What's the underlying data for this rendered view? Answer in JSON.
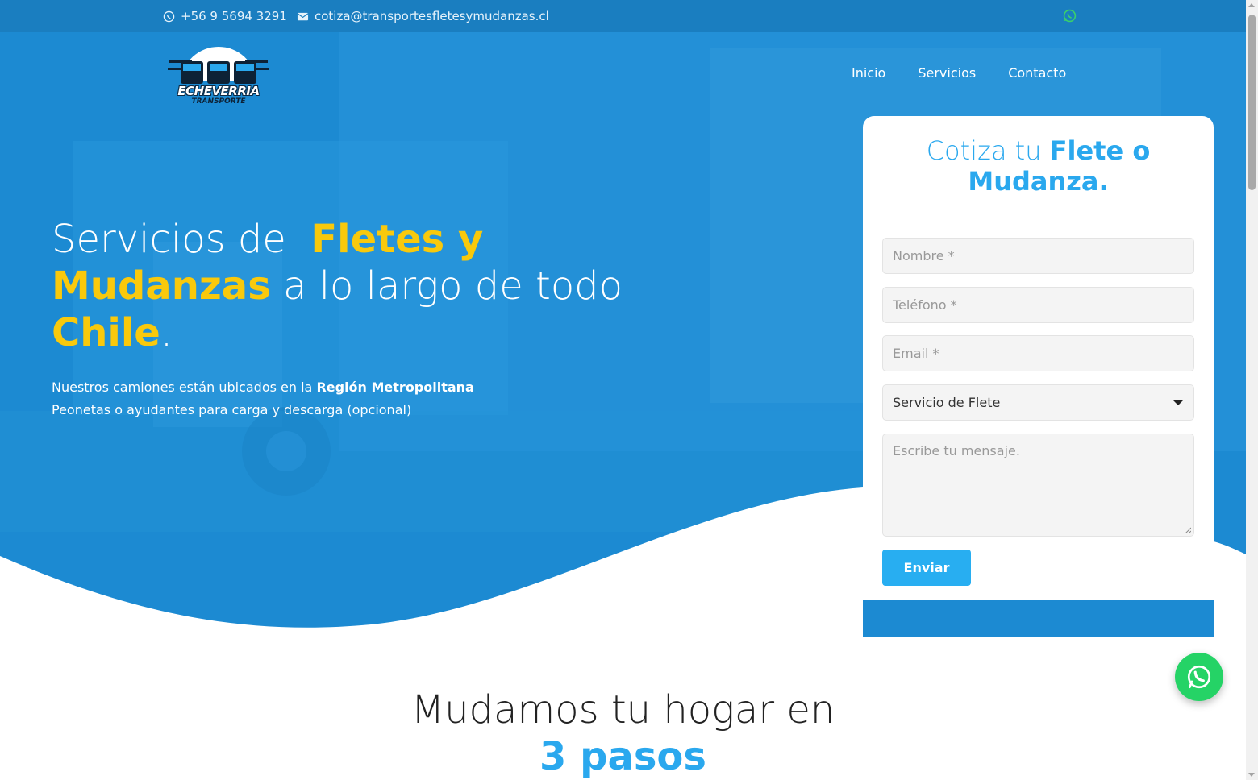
{
  "topbar": {
    "phone": "+56 9 5694 3291",
    "email": "cotiza@transportesfletesymudanzas.cl",
    "phone_icon": "whatsapp-icon",
    "email_icon": "envelope-icon",
    "social_icon": "whatsapp-icon"
  },
  "brand": {
    "name": "ECHEVERRIA",
    "sub": "TRANSPORTE"
  },
  "nav": {
    "items": [
      "Inicio",
      "Servicios",
      "Contacto"
    ]
  },
  "hero": {
    "title_part1": "Servicios de",
    "title_hl1": "Fletes y Mudanzas",
    "title_part2": "a lo largo de todo",
    "title_hl2": "Chile",
    "title_end": ".",
    "line1_prefix": "Nuestros camiones están ubicados en la",
    "line1_bold": "Región Metropolitana",
    "line2": "Peonetas o ayudantes para carga y descarga (opcional)"
  },
  "form": {
    "title_light": "Cotiza tu",
    "title_bold": "Flete o Mudanza.",
    "name_placeholder": "Nombre *",
    "phone_placeholder": "Teléfono  *",
    "email_placeholder": "Email *",
    "service_selected": "Servicio de Flete",
    "message_placeholder": "Escribe tu mensaje.",
    "submit": "Enviar"
  },
  "section": {
    "title": "Mudamos tu hogar en",
    "accent": "3 pasos"
  },
  "colors": {
    "primary_blue": "#1f8fd6",
    "accent_yellow": "#f9c90c",
    "button_blue": "#28aef1",
    "whatsapp_green": "#25d366"
  }
}
